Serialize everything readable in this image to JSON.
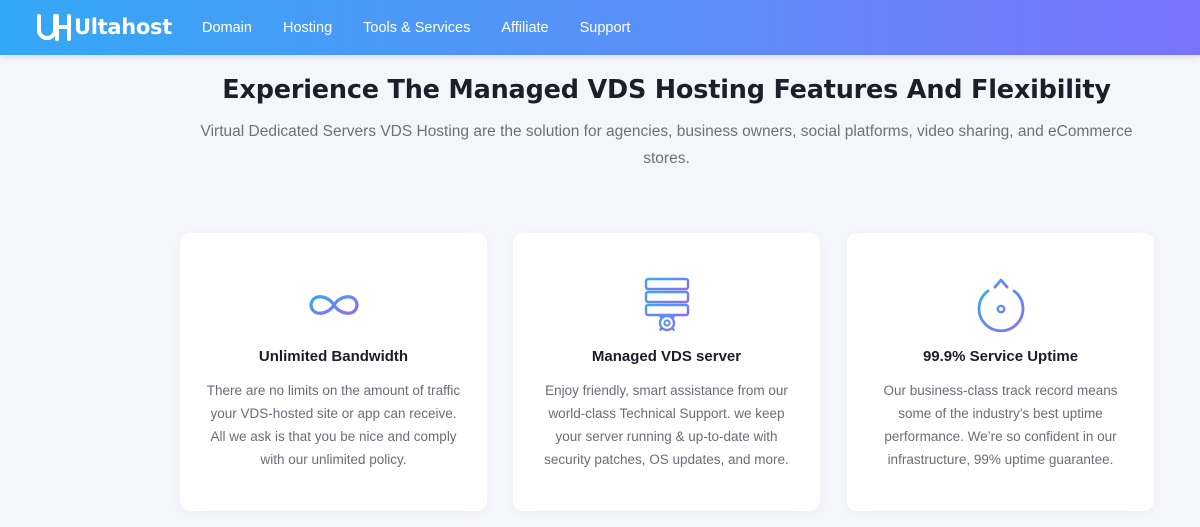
{
  "header": {
    "logo_text": "Ultahost",
    "nav": [
      {
        "label": "Domain"
      },
      {
        "label": "Hosting"
      },
      {
        "label": "Tools & Services"
      },
      {
        "label": "Affiliate"
      },
      {
        "label": "Support"
      }
    ]
  },
  "hero": {
    "title": "Experience The Managed VDS Hosting Features And Flexibility",
    "subtitle": "Virtual Dedicated Servers VDS Hosting are the solution for agencies, business owners, social platforms, video sharing, and eCommerce stores."
  },
  "features": [
    {
      "icon": "infinity-icon",
      "title": "Unlimited Bandwidth",
      "text": "There are no limits on the amount of traffic your VDS-hosted site or app can receive. All we ask is that you be nice and comply with our unlimited policy."
    },
    {
      "icon": "server-gear-icon",
      "title": "Managed VDS server",
      "text": "Enjoy friendly, smart assistance from our world-class Technical Support. we keep your server running & up-to-date with security patches, OS updates, and more."
    },
    {
      "icon": "uptime-clock-icon",
      "title": "99.9% Service Uptime",
      "text": "Our business-class track record means some of the industry’s best uptime performance. We’re so confident in our infrastructure, 99% uptime guarantee."
    }
  ],
  "colors": {
    "nav_gradient_start": "#33a8f5",
    "nav_gradient_end": "#7a73fa",
    "icon_gradient_start": "#3aa6f4",
    "icon_gradient_end": "#8a6cf7",
    "page_background": "#f5f6fb"
  }
}
